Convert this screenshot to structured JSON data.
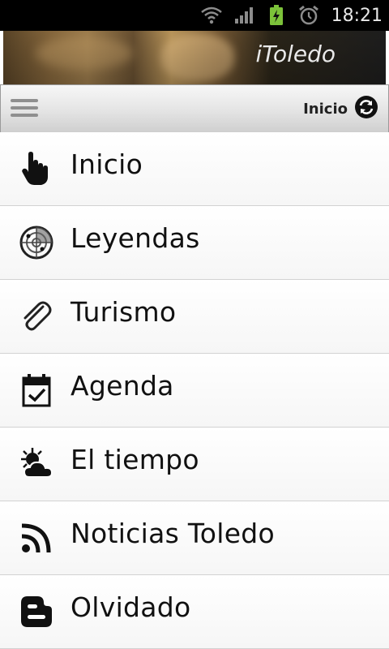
{
  "status_bar": {
    "time": "18:21",
    "icons": [
      "wifi-icon",
      "signal-icon",
      "battery-charging-icon",
      "alarm-icon"
    ]
  },
  "banner": {
    "title": "iToledo"
  },
  "action_bar": {
    "current_label": "Inicio",
    "refresh_icon": "refresh-icon",
    "menu_icon": "menu-icon"
  },
  "menu": {
    "items": [
      {
        "label": "Inicio",
        "icon": "hand-pointer-icon"
      },
      {
        "label": "Leyendas",
        "icon": "radar-icon"
      },
      {
        "label": "Turismo",
        "icon": "paperclip-icon"
      },
      {
        "label": "Agenda",
        "icon": "calendar-check-icon"
      },
      {
        "label": "El tiempo",
        "icon": "weather-icon"
      },
      {
        "label": "Noticias Toledo",
        "icon": "rss-icon"
      },
      {
        "label": "Olvidado",
        "icon": "blogger-icon"
      }
    ]
  }
}
